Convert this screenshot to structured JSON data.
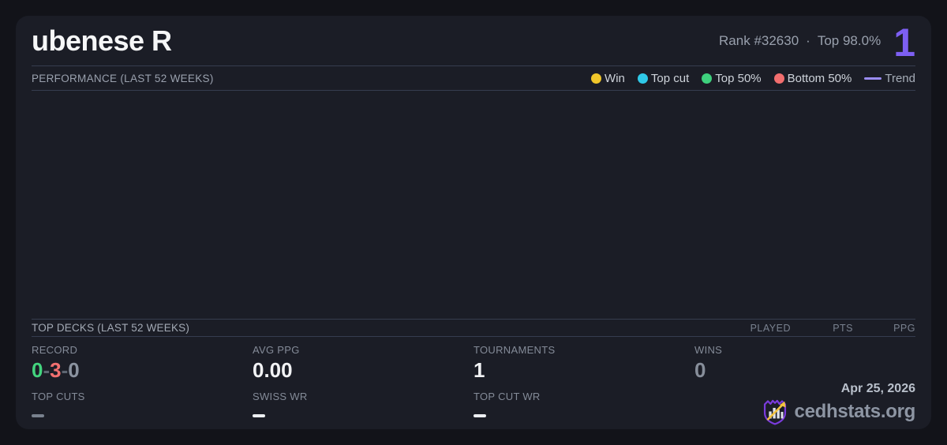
{
  "header": {
    "player_name": "ubenese R",
    "rank": "Rank #32630",
    "separator": "·",
    "top_percent": "Top 98.0%",
    "count_badge": "1"
  },
  "performance": {
    "title": "PERFORMANCE (LAST 52 WEEKS)",
    "legend": [
      {
        "label": "Win",
        "color": "#f0c62a"
      },
      {
        "label": "Top cut",
        "color": "#2fc9e8"
      },
      {
        "label": "Top 50%",
        "color": "#3ed17d"
      },
      {
        "label": "Bottom 50%",
        "color": "#f26e6e"
      },
      {
        "label": "Trend",
        "color": "#9a8cf2"
      }
    ]
  },
  "chart_data": {
    "type": "scatter",
    "title": "PERFORMANCE (LAST 52 WEEKS)",
    "points": [],
    "legend": [
      "Win",
      "Top cut",
      "Top 50%",
      "Bottom 50%",
      "Trend"
    ],
    "grid": false
  },
  "top_decks": {
    "title": "TOP DECKS (LAST 52 WEEKS)",
    "columns": [
      "PLAYED",
      "PTS",
      "PPG"
    ],
    "rows": []
  },
  "stats": {
    "record": {
      "label": "RECORD",
      "parts": [
        {
          "text": "0",
          "color": "#43d47e"
        },
        {
          "text": "-",
          "color": "#5d6571"
        },
        {
          "text": "3",
          "color": "#f17070"
        },
        {
          "text": "-",
          "color": "#5d6571"
        },
        {
          "text": "0",
          "color": "#8b93a0"
        }
      ]
    },
    "avg_ppg": {
      "label": "AVG PPG",
      "value": "0.00"
    },
    "tournaments": {
      "label": "TOURNAMENTS",
      "value": "1"
    },
    "wins": {
      "label": "WINS",
      "value": "0",
      "value_color": "#878e9a"
    },
    "top_cuts": {
      "label": "TOP CUTS",
      "value": "—",
      "dash_color": "#79818e"
    },
    "swiss_wr": {
      "label": "SWISS WR",
      "value": "—",
      "dash_color": "#edeff2"
    },
    "top_cut_wr": {
      "label": "TOP CUT WR",
      "value": "—",
      "dash_color": "#edeff2"
    }
  },
  "footer": {
    "date": "Apr 25, 2026",
    "brand": "cedhstats.org"
  },
  "colors": {
    "page_bg": "#121319",
    "card_bg": "#1b1d26",
    "divider": "#363d4f",
    "accent_purple": "#7d5ff2",
    "logo_purple": "#7a3bdc",
    "logo_gold": "#f3c43e"
  }
}
